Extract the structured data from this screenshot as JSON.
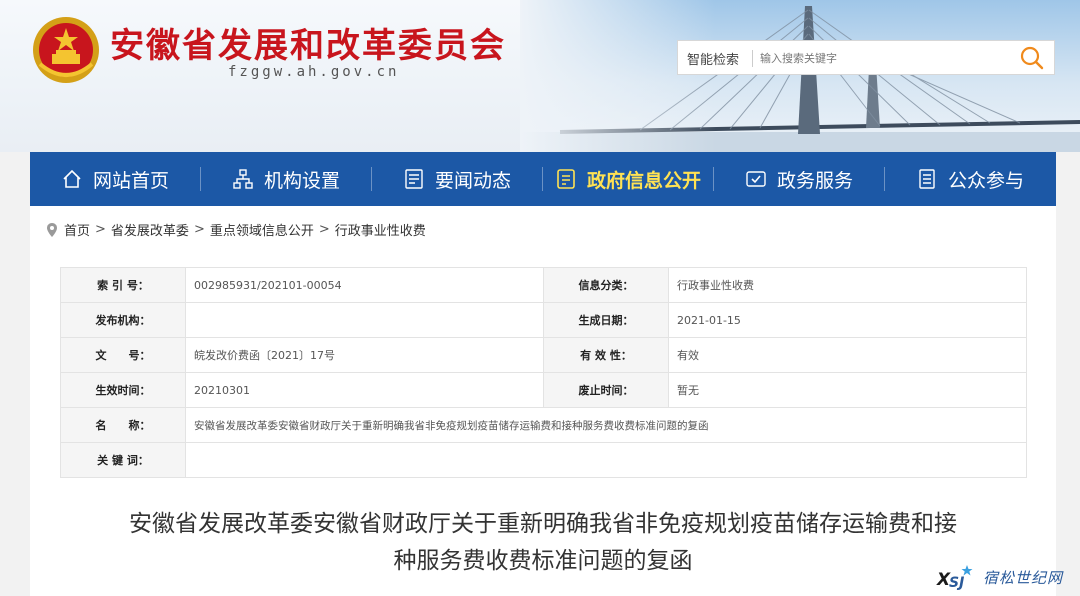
{
  "header": {
    "site_title": "安徽省发展和改革委员会",
    "site_domain": "fzggw.ah.gov.cn",
    "search": {
      "label": "智能检索",
      "placeholder": "输入搜索关键字",
      "icon": "search-icon"
    },
    "emblem_icon": "national-emblem-icon"
  },
  "nav": {
    "items": [
      {
        "label": "网站首页",
        "icon": "home-icon",
        "active": false
      },
      {
        "label": "机构设置",
        "icon": "org-chart-icon",
        "active": false
      },
      {
        "label": "要闻动态",
        "icon": "news-icon",
        "active": false
      },
      {
        "label": "政府信息公开",
        "icon": "document-icon",
        "active": true
      },
      {
        "label": "政务服务",
        "icon": "service-icon",
        "active": false
      },
      {
        "label": "公众参与",
        "icon": "participation-icon",
        "active": false
      }
    ],
    "active_color": "#ffe253",
    "bg_color": "#1c58a6"
  },
  "breadcrumb": {
    "icon": "location-pin-icon",
    "items": [
      "首页",
      "省发展改革委",
      "重点领域信息公开",
      "行政事业性收费"
    ],
    "separator": ">"
  },
  "info_table": {
    "index_label": "索 引 号：",
    "index_value": "002985931/202101-00054",
    "category_label": "信息分类：",
    "category_value": "行政事业性收费",
    "publisher_label": "发布机构：",
    "publisher_value": "",
    "created_label": "生成日期：",
    "created_value": "2021-01-15",
    "docno_label": "文　　号：",
    "docno_value": "皖发改价费函〔2021〕17号",
    "validity_label": "有 效 性：",
    "validity_value": "有效",
    "effective_label": "生效时间：",
    "effective_value": "20210301",
    "repeal_label": "废止时间：",
    "repeal_value": "暂无",
    "name_label": "名　　称：",
    "name_value": "安徽省发展改革委安徽省财政厅关于重新明确我省非免疫规划疫苗储存运输费和接种服务费收费标准问题的复函",
    "keywords_label": "关 键 词：",
    "keywords_value": ""
  },
  "document": {
    "title_line1": "安徽省发展改革委安徽省财政厅关于重新明确我省非免疫规划疫苗储存运输费和接",
    "title_line2": "种服务费收费标准问题的复函"
  },
  "watermark": {
    "logo_text": "XSJ",
    "text": "宿松世纪网"
  },
  "colors": {
    "brand_red": "#c8151d",
    "nav_blue": "#1c58a6",
    "search_orange": "#f08a1c"
  }
}
